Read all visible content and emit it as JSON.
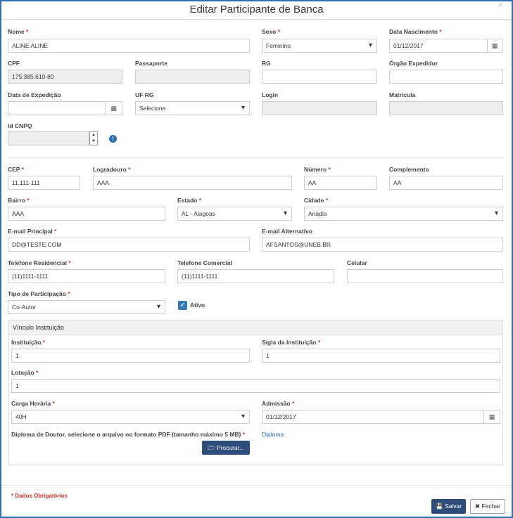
{
  "title": "Editar Participante de Banca",
  "close_glyph": "×",
  "fields": {
    "nome": {
      "label": "Nome",
      "value": "ALINE ALINE"
    },
    "sexo": {
      "label": "Sexo",
      "value": "Feminino"
    },
    "data_nasc": {
      "label": "Data Nascimento",
      "value": "01/12/2017"
    },
    "cpf": {
      "label": "CPF",
      "value": "175.385.610-80"
    },
    "passaporte": {
      "label": "Passaporte",
      "value": ""
    },
    "rg": {
      "label": "RG",
      "value": ""
    },
    "orgao": {
      "label": "Órgão Expedidor",
      "value": ""
    },
    "data_exp": {
      "label": "Data de Expedição",
      "value": ""
    },
    "uf_rg": {
      "label": "UF RG",
      "value": "Selecione"
    },
    "login": {
      "label": "Login",
      "value": ""
    },
    "matricula": {
      "label": "Matrícula",
      "value": ""
    },
    "id_cnpq": {
      "label": "Id CNPQ",
      "value": ""
    },
    "cep": {
      "label": "CEP",
      "value": "11.111-111"
    },
    "logradouro": {
      "label": "Logradouro",
      "value": "AAA"
    },
    "numero": {
      "label": "Número",
      "value": "AA"
    },
    "complemento": {
      "label": "Complemento",
      "value": "AA"
    },
    "bairro": {
      "label": "Bairro",
      "value": "AAA"
    },
    "estado": {
      "label": "Estado",
      "value": "AL - Alagoas"
    },
    "cidade": {
      "label": "Cidade",
      "value": "Anadia"
    },
    "email_principal": {
      "label": "E-mail Principal",
      "value": "DD@TESTE.COM"
    },
    "email_alternativo": {
      "label": "E-mail Alternativo",
      "value": "AFSANTOS@UNEB.BR"
    },
    "tel_res": {
      "label": "Telefone Residencial",
      "value": "(11)1111-1111"
    },
    "tel_com": {
      "label": "Telefone Comercial",
      "value": "(11)1111-1111"
    },
    "celular": {
      "label": "Celular",
      "value": ""
    },
    "tipo_part": {
      "label": "Tipo de Participação",
      "value": "Co-Autor"
    },
    "ativo": {
      "label": "Ativo",
      "checked": true
    }
  },
  "vinculo": {
    "heading": "Vínculo Instituição",
    "instituicao": {
      "label": "Instituição",
      "value": "1"
    },
    "sigla": {
      "label": "Sigla da Instituição",
      "value": "1"
    },
    "lotacao": {
      "label": "Lotação",
      "value": "1"
    },
    "carga": {
      "label": "Carga Horária",
      "value": "40H"
    },
    "admissao": {
      "label": "Admissão",
      "value": "01/12/2017"
    },
    "diploma_label": "Diploma de Doutor, selecione o arquivo no formato PDF (tamanho máximo 5 MB)",
    "procurar_label": "Procurar...",
    "diploma_link": "Diploma"
  },
  "required_mark": "*",
  "footer": {
    "obrigatorios": "* Dados Obrigatórios",
    "salvar": "Salvar",
    "fechar": "Fechar"
  }
}
